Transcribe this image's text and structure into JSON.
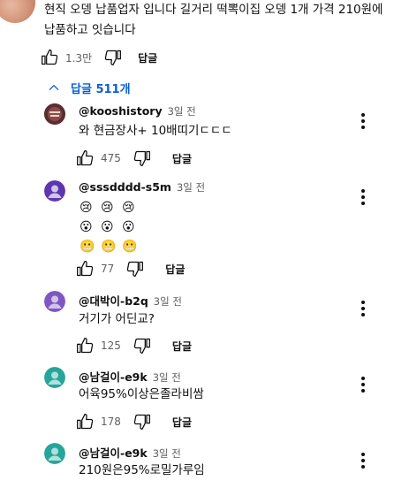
{
  "top_comment": {
    "text": "현직 오뎅 납품업자 입니다 길거리 떡뽁이집 오뎅 1개 가격 210원에 납품하고 잇습니다",
    "like_count": "1.3만",
    "reply_label": "답글"
  },
  "replies_toggle": {
    "label": "답글 511개"
  },
  "replies": [
    {
      "handle": "@kooshistory",
      "time": "3일 전",
      "text": "와 현금장사+ 10배띠기ㄷㄷㄷ",
      "like_count": "475",
      "reply_label": "답글",
      "avatar_color": "#6b3a3a"
    },
    {
      "handle": "@sssdddd-s5m",
      "time": "3일 전",
      "emoji_rows": [
        [
          "😢",
          "😢",
          "😢"
        ],
        [
          "😮",
          "😮",
          "😮"
        ],
        [
          "😬",
          "😬",
          "😬"
        ]
      ],
      "like_count": "77",
      "reply_label": "답글",
      "avatar_color": "#5e35b1"
    },
    {
      "handle": "@대박이-b2q",
      "time": "3일 전",
      "text": "거기가 어딘교?",
      "like_count": "125",
      "reply_label": "답글",
      "avatar_color": "#7e57c2"
    },
    {
      "handle": "@남걸이-e9k",
      "time": "3일 전",
      "text": "어육95%이상은졸라비쌈",
      "like_count": "178",
      "reply_label": "답글",
      "avatar_color": "#26a69a"
    },
    {
      "handle": "@남걸이-e9k",
      "time": "3일 전",
      "text": "210원은95%로밀가루임",
      "avatar_color": "#26a69a"
    }
  ],
  "icons": {
    "like": "thumb-up-icon",
    "dislike": "thumb-down-icon",
    "more": "more-vert-icon",
    "chevron": "chevron-up-icon",
    "avatar": "person-icon"
  },
  "colors": {
    "link": "#065fd4",
    "text": "#0f0f0f",
    "muted": "#606060"
  }
}
